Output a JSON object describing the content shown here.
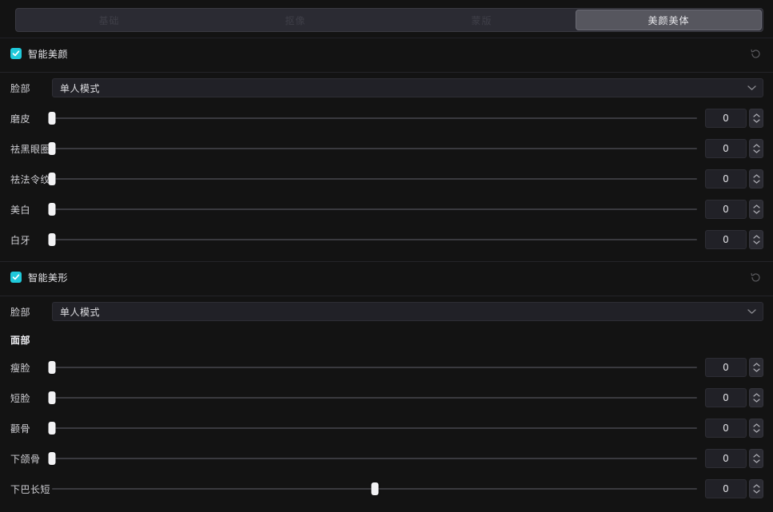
{
  "tabs": [
    {
      "label": "基础",
      "active": false
    },
    {
      "label": "抠像",
      "active": false
    },
    {
      "label": "蒙版",
      "active": false
    },
    {
      "label": "美颜美体",
      "active": true
    }
  ],
  "colors": {
    "accent": "#1fc9da",
    "panel_bg": "#131313",
    "tabbar_bg": "#2b2b33",
    "tab_active_bg": "#56565e",
    "field_bg": "#212127",
    "track": "#3a3a3f",
    "knob": "#f2f2f4"
  },
  "sections": [
    {
      "id": "smart-beauty",
      "title": "智能美颜",
      "enabled": true,
      "reset_icon": "reset-icon",
      "mode_row": {
        "label": "脸部",
        "value": "单人模式",
        "caret_icon": "chevron-down-icon"
      },
      "sliders": [
        {
          "label": "磨皮",
          "value": "0",
          "percent": 0
        },
        {
          "label": "祛黑眼圈",
          "value": "0",
          "percent": 0
        },
        {
          "label": "祛法令纹",
          "value": "0",
          "percent": 0
        },
        {
          "label": "美白",
          "value": "0",
          "percent": 0
        },
        {
          "label": "白牙",
          "value": "0",
          "percent": 0
        }
      ]
    },
    {
      "id": "smart-reshape",
      "title": "智能美形",
      "enabled": true,
      "reset_icon": "reset-icon",
      "mode_row": {
        "label": "脸部",
        "value": "单人模式",
        "caret_icon": "chevron-down-icon"
      },
      "subheading": "面部",
      "sliders": [
        {
          "label": "瘦脸",
          "value": "0",
          "percent": 0
        },
        {
          "label": "短脸",
          "value": "0",
          "percent": 0
        },
        {
          "label": "颧骨",
          "value": "0",
          "percent": 0
        },
        {
          "label": "下颌骨",
          "value": "0",
          "percent": 0
        },
        {
          "label": "下巴长短",
          "value": "0",
          "percent": 50
        }
      ]
    }
  ]
}
